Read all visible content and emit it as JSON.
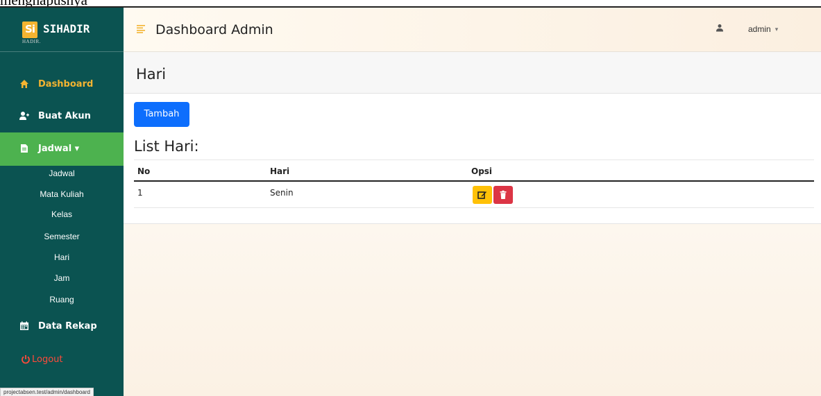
{
  "document": {
    "caption_fragment": "menghapusnya"
  },
  "status_bar": {
    "url": "projectabsen.test/admin/dashboard"
  },
  "brand": {
    "logo_mark": "Si",
    "logo_subtext": "HADIR.",
    "name": "SIHADIR"
  },
  "sidebar": {
    "items": [
      {
        "label": "Dashboard",
        "icon": "home-icon"
      },
      {
        "label": "Buat Akun",
        "icon": "user-plus-icon"
      },
      {
        "label": "Jadwal ▾",
        "icon": "file-icon",
        "active": true
      },
      {
        "label": "Data Rekap",
        "icon": "calendar-icon"
      },
      {
        "label": "Logout",
        "icon": "power-icon"
      }
    ],
    "jadwal_submenu": [
      "Jadwal",
      "Mata Kuliah",
      "Kelas",
      "Semester",
      "Hari",
      "Jam",
      "Ruang"
    ]
  },
  "topbar": {
    "title": "Dashboard Admin",
    "user": "admin",
    "caret": "▾"
  },
  "page": {
    "title": "Hari",
    "add_button": "Tambah",
    "list_title": "List Hari:",
    "table": {
      "headers": [
        "No",
        "Hari",
        "Opsi"
      ],
      "rows": [
        {
          "no": "1",
          "hari": "Senin"
        }
      ]
    }
  },
  "colors": {
    "sidebar": "#0b5351",
    "active": "#4db24f",
    "accent": "#f3b431",
    "primary": "#0d6efd",
    "warning": "#ffc107",
    "danger": "#dc3545",
    "logout": "#ff4a3a"
  }
}
